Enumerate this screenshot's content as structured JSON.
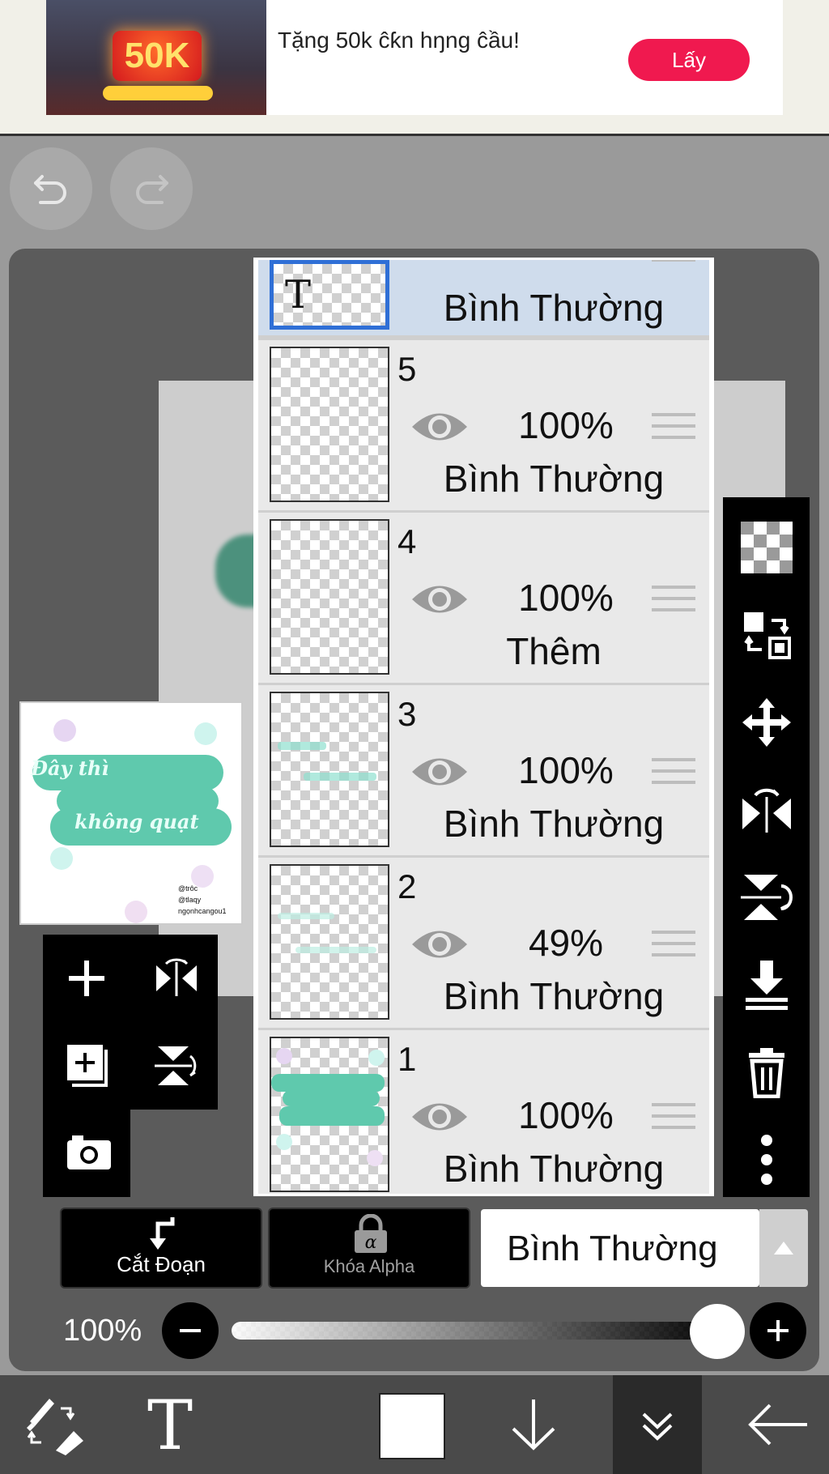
{
  "ad": {
    "image_big_text": "50K",
    "text": "Tặng 50k ĉƙn hŋng ĉầu!",
    "button_label": "Lấy",
    "brand_color": "#f0194f"
  },
  "layers": [
    {
      "number": "",
      "opacity": "",
      "blend": "Bình Thường",
      "selected": true,
      "type_icon": "T"
    },
    {
      "number": "5",
      "opacity": "100%",
      "blend": "Bình Thường"
    },
    {
      "number": "4",
      "opacity": "100%",
      "blend": "Thêm"
    },
    {
      "number": "3",
      "opacity": "100%",
      "blend": "Bình Thường"
    },
    {
      "number": "2",
      "opacity": "49%",
      "blend": "Bình Thường"
    },
    {
      "number": "1",
      "opacity": "100%",
      "blend": "Bình Thường"
    }
  ],
  "thumbnail": {
    "line1": "Đây thì",
    "line2": "không quạt",
    "credit": [
      "@trôc",
      "@tlaqy",
      "ngọnhcangou1"
    ]
  },
  "controls": {
    "clip_label": "Cắt Đoạn",
    "alpha_lock_label": "Khóa Alpha",
    "blend_mode": "Bình Thường",
    "opacity_label": "100%",
    "opacity_value": 1.0
  },
  "icons": {
    "undo": "undo-icon",
    "redo": "redo-icon",
    "right_toolbar": [
      "transparency-icon",
      "swap-layers-icon",
      "move-icon",
      "flip-horizontal-icon",
      "flip-vertical-icon",
      "merge-down-icon",
      "trash-icon",
      "more-icon"
    ],
    "left_tools": [
      "add-layer-icon",
      "flip-icon",
      "add-copy-layer-icon",
      "flip-vertical-icon",
      "camera-icon"
    ],
    "appbar": [
      "brush-eraser-icon",
      "text-icon",
      "color-swatch",
      "download-arrow-icon",
      "collapse-icon",
      "back-arrow-icon"
    ]
  }
}
